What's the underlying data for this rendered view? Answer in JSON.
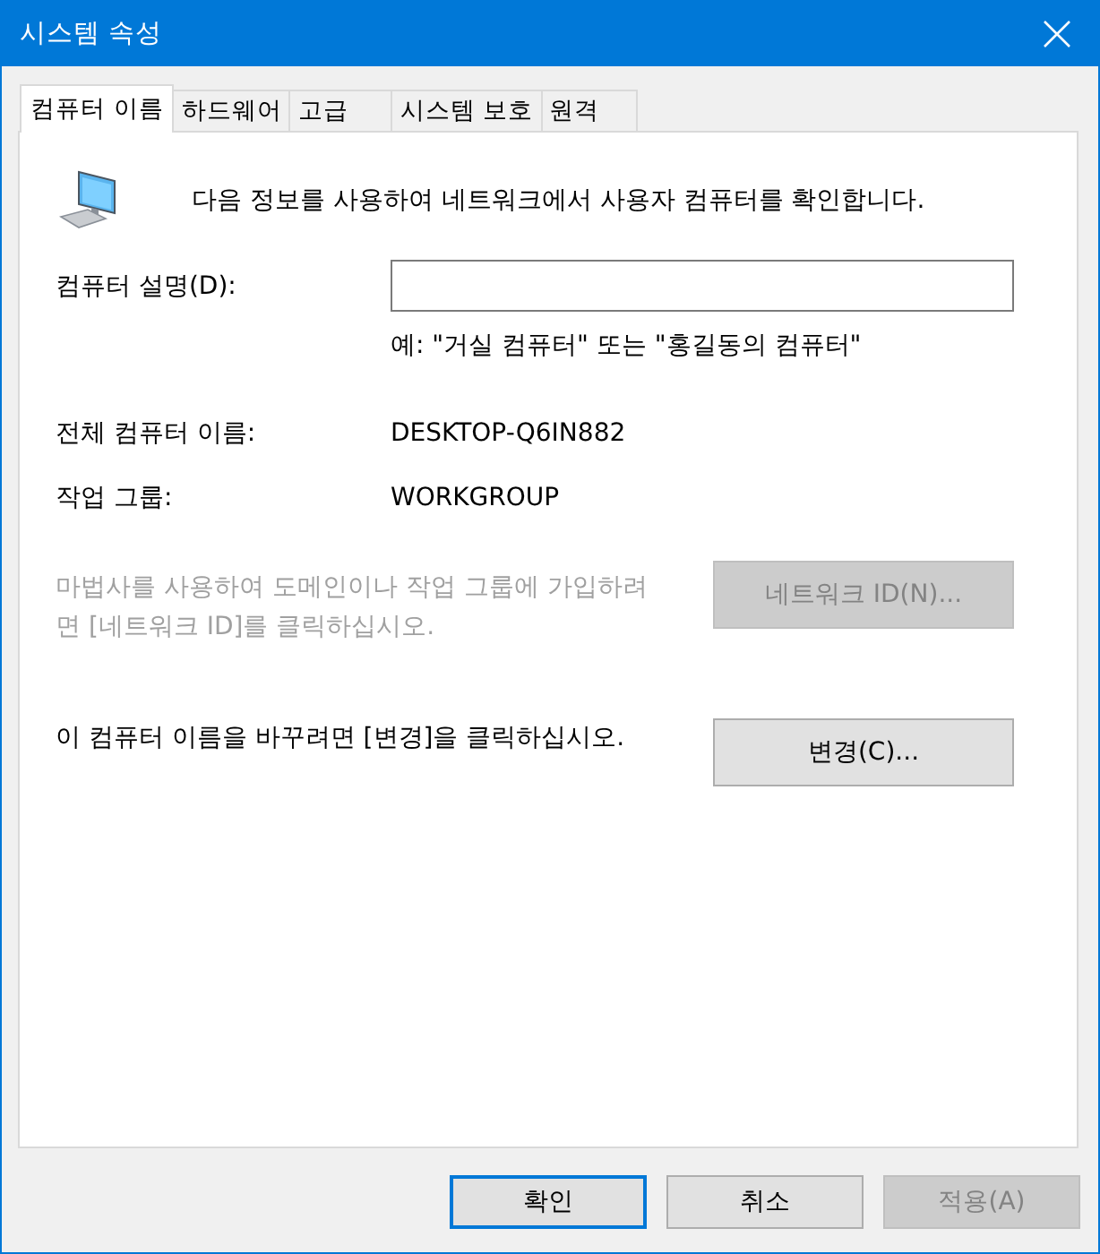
{
  "window": {
    "title": "시스템 속성"
  },
  "tabs": [
    {
      "label": "컴퓨터 이름",
      "selected": true
    },
    {
      "label": "하드웨어",
      "selected": false
    },
    {
      "label": "고급",
      "selected": false
    },
    {
      "label": "시스템 보호",
      "selected": false
    },
    {
      "label": "원격",
      "selected": false
    }
  ],
  "intro": "다음 정보를 사용하여 네트워크에서 사용자 컴퓨터를 확인합니다.",
  "description": {
    "label": "컴퓨터 설명(D):",
    "hint": "예: \"거실 컴퓨터\" 또는 \"홍길동의 컴퓨터\""
  },
  "info": [
    {
      "label": "전체 컴퓨터 이름:",
      "value": "DESKTOP-Q6IN882"
    },
    {
      "label": "작업 그룹:",
      "value": "WORKGROUP"
    }
  ],
  "actions": [
    {
      "text": "마법사를 사용하여 도메인이나 작업 그룹에 가입하려면 [네트워크 ID]를 클릭하십시오.",
      "button": "네트워크 ID(N)...",
      "disabled": true
    },
    {
      "text": "이 컴퓨터 이름을 바꾸려면 [변경]을 클릭하십시오.",
      "button": "변경(C)...",
      "disabled": false
    }
  ],
  "buttons": [
    {
      "label": "확인",
      "default": true,
      "disabled": false
    },
    {
      "label": "취소",
      "default": false,
      "disabled": false
    },
    {
      "label": "적용(A)",
      "default": false,
      "disabled": true
    }
  ]
}
